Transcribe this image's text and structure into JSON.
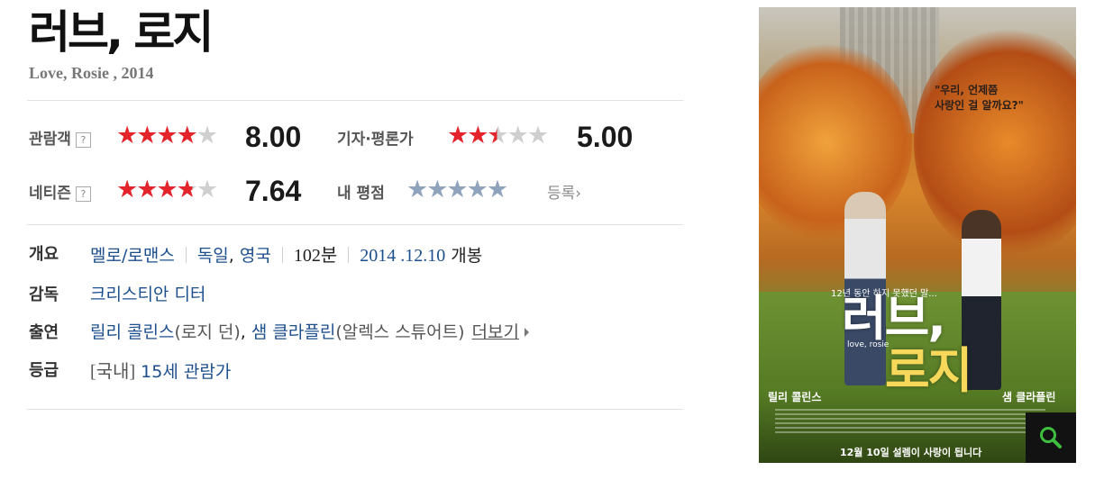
{
  "movie": {
    "title": "러브, 로지",
    "subtitle": "Love, Rosie , 2014"
  },
  "ratings": {
    "audience": {
      "label": "관람객",
      "score": "8.00",
      "stars": 4
    },
    "critics": {
      "label": "기자·평론가",
      "score": "5.00",
      "stars": 2.5
    },
    "netizen": {
      "label": "네티즌",
      "score": "7.64",
      "stars": 3.8
    },
    "mine": {
      "label": "내 평점",
      "register_label": "등록",
      "stars": 0
    },
    "help_mark": "?"
  },
  "info": {
    "overview_label": "개요",
    "genre": "멜로/로맨스",
    "country1": "독일",
    "country_sep": ",",
    "country2": "영국",
    "runtime": "102분",
    "release_date": "2014 .12.10",
    "release_suffix": "개봉",
    "director_label": "감독",
    "director": "크리스티안 디터",
    "cast_label": "출연",
    "cast1": "릴리 콜린스",
    "cast1_role": "(로지 던)",
    "cast_sep": ",",
    "cast2": "샘 클라플린",
    "cast2_role": "(알렉스 스튜어트)",
    "more_label": "더보기",
    "grade_label": "등급",
    "grade_prefix": "[국내]",
    "grade": "15세 관람가"
  },
  "poster": {
    "quote_line1": "\"우리, 언제쯤",
    "quote_line2": "사랑인 걸 알까요?\"",
    "tagline": "12년 동안 하지 못했던 말...",
    "title_line1": "러브,",
    "title_line2": "로지",
    "title_en": "love, rosie",
    "cast_left": "릴리 콜린스",
    "cast_right": "샘 클라플린",
    "release_text": "12월 10일  설렘이 사랑이 됩니다"
  },
  "colors": {
    "star_filled": "#e3242b",
    "star_empty": "#cfcfcf",
    "star_mine": "#8fa3bd",
    "link_blue": "#1c4f8c"
  }
}
